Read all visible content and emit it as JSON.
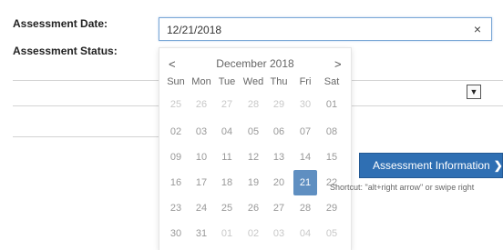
{
  "labels": {
    "assessment_date": "Assessment Date:",
    "assessment_status": "Assessment Status:"
  },
  "date_input": {
    "value": "12/21/2018",
    "clear_glyph": "×"
  },
  "status_select": {
    "arrow_glyph": "▼"
  },
  "datepicker": {
    "prev": "<",
    "next": ">",
    "month_label": "December 2018",
    "weekdays": [
      "Sun",
      "Mon",
      "Tue",
      "Wed",
      "Thu",
      "Fri",
      "Sat"
    ],
    "weeks": [
      [
        "25",
        "26",
        "27",
        "28",
        "29",
        "30",
        "01"
      ],
      [
        "02",
        "03",
        "04",
        "05",
        "06",
        "07",
        "08"
      ],
      [
        "09",
        "10",
        "11",
        "12",
        "13",
        "14",
        "15"
      ],
      [
        "16",
        "17",
        "18",
        "19",
        "20",
        "21",
        "22"
      ],
      [
        "23",
        "24",
        "25",
        "26",
        "27",
        "28",
        "29"
      ],
      [
        "30",
        "31",
        "01",
        "02",
        "03",
        "04",
        "05"
      ]
    ],
    "selected": "21"
  },
  "assessment_button": {
    "label": "Assessment Information",
    "chevron": "❯"
  },
  "shortcut_text": "Shortcut: \"alt+right arrow\" or swipe right",
  "colors": {
    "accent": "#2f6fb3",
    "selected_day": "#5f8fc1"
  }
}
